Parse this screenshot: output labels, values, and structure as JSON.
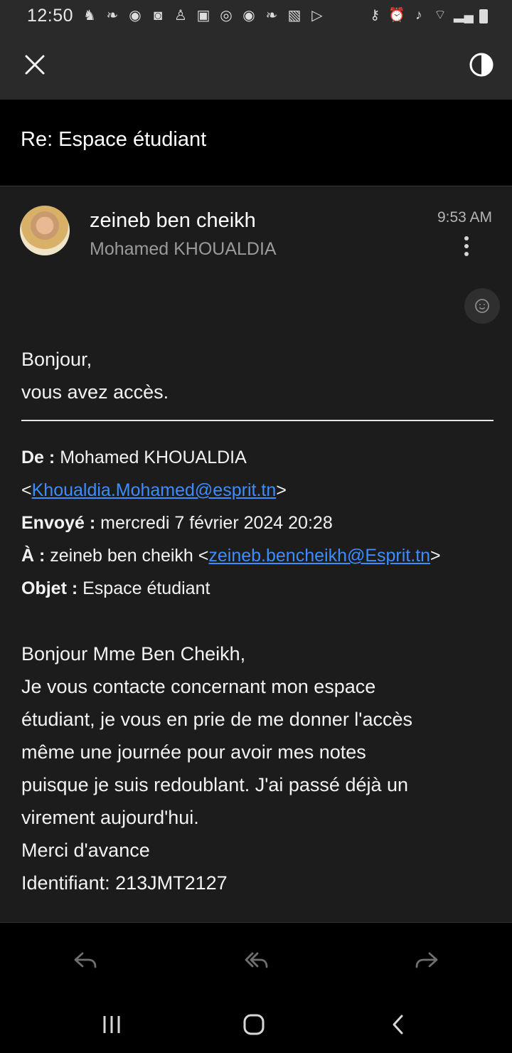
{
  "status_bar": {
    "time": "12:50",
    "notification_icons": [
      "notification-icon",
      "leaf-icon",
      "reddit-icon",
      "coin-icon",
      "person-icon",
      "m-icon",
      "swirl-icon",
      "s-coin-icon",
      "leaf-icon",
      "gallery-icon",
      "play-icon"
    ],
    "system_icons": [
      "key-icon",
      "alarm-icon",
      "mute-icon",
      "wifi-icon",
      "signal-icon",
      "battery-icon"
    ]
  },
  "toolbar": {
    "close_icon": "close-icon",
    "contrast_icon": "contrast-icon"
  },
  "email": {
    "subject": "Re: Espace étudiant",
    "sender_name": "zeineb ben cheikh",
    "recipient": "Mohamed KHOUALDIA",
    "time": "9:53 AM",
    "greeting": "Bonjour,",
    "reply_line": "vous avez accès.",
    "meta": {
      "from_label": "De :",
      "from_name": "Mohamed KHOUALDIA",
      "from_email": "Khoualdia.Mohamed@esprit.tn",
      "sent_label": "Envoyé :",
      "sent_value": "mercredi 7 février 2024 20:28",
      "to_label": "À :",
      "to_name": "zeineb ben cheikh",
      "to_email": "zeineb.bencheikh@Esprit.tn",
      "subject_label": "Objet :",
      "subject_value": "Espace étudiant"
    },
    "message_lines": [
      "Bonjour Mme Ben Cheikh,",
      "Je vous contacte concernant mon espace",
      "étudiant, je vous en prie de me donner l'accès",
      "même une journée pour avoir mes notes",
      "puisque je suis redoublant. J'ai passé déjà un",
      "virement aujourd'hui.",
      "Merci d'avance",
      "Identifiant: 213JMT2127"
    ]
  },
  "actions": [
    "reply-icon",
    "reply-all-icon",
    "forward-icon"
  ],
  "navigation": [
    "recent-apps-icon",
    "home-icon",
    "back-icon"
  ],
  "colors": {
    "background": "#1c1c1c",
    "header": "#2a2a2a",
    "subject_bar": "#000000",
    "link": "#3d8dff"
  }
}
